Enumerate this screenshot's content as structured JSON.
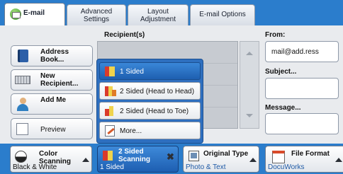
{
  "tabs": {
    "email": "E-mail",
    "advanced": "Advanced\nSettings",
    "layout": "Layout\nAdjustment",
    "options": "E-mail Options"
  },
  "left": {
    "address_book": "Address\nBook...",
    "new_recipient": "New\nRecipient...",
    "add_me": "Add Me",
    "preview": "Preview"
  },
  "recipients": {
    "header": "Recipient(s)"
  },
  "popup": {
    "options": [
      "1 Sided",
      "2 Sided (Head to Head)",
      "2 Sided (Head to Toe)",
      "More..."
    ],
    "selected_index": 0
  },
  "right": {
    "from_label": "From:",
    "from_value": "mail@add.ress",
    "subject_label": "Subject...",
    "message_label": "Message..."
  },
  "bottom": {
    "color_label": "Color\nScanning",
    "color_value": "Black & White",
    "sided_label": "2 Sided\nScanning",
    "sided_value": "1 Sided",
    "original_label": "Original Type",
    "original_value": "Photo & Text",
    "file_label": "File Format",
    "file_value": "DocuWorks"
  },
  "colors": {
    "accent": "#2b7dcc",
    "selected": "#1e5fb0"
  }
}
